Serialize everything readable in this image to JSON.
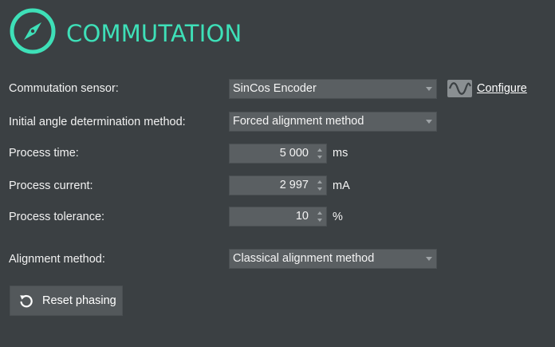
{
  "header": {
    "title": "COMMUTATION",
    "icon": "compass-icon"
  },
  "fields": {
    "commutation_sensor": {
      "label": "Commutation sensor:",
      "value": "SinCos Encoder"
    },
    "configure": {
      "label": "Configure",
      "icon": "sine-wave-icon"
    },
    "initial_angle": {
      "label": "Initial angle determination method:",
      "value": "Forced alignment method"
    },
    "process_time": {
      "label": "Process time:",
      "value": "5 000",
      "unit": "ms"
    },
    "process_current": {
      "label": "Process current:",
      "value": "2 997",
      "unit": "mA"
    },
    "process_tolerance": {
      "label": "Process tolerance:",
      "value": "10",
      "unit": "%"
    },
    "alignment_method": {
      "label": "Alignment method:",
      "value": "Classical alignment method"
    }
  },
  "reset_button": {
    "label": "Reset phasing",
    "icon": "reset-icon"
  },
  "colors": {
    "accent": "#3ee0b8",
    "background": "#3b4043",
    "input": "#5a5f62"
  }
}
